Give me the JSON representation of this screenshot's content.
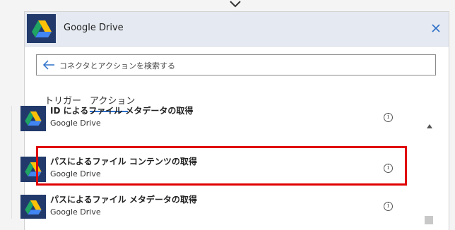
{
  "header": {
    "title": "Google Drive",
    "icon": "google-drive-icon",
    "close_icon": "close-icon"
  },
  "search": {
    "placeholder": "コネクタとアクションを検索する",
    "back_icon": "arrow-left-icon"
  },
  "tabs": [
    {
      "label": "トリガー",
      "selected": false
    },
    {
      "label": "アクション",
      "selected": true
    }
  ],
  "actions": [
    {
      "title": "ID によるファイル メタデータの取得",
      "subtitle": "Google Drive",
      "info": "i"
    },
    {
      "title": "パスによるファイル コンテンツの取得",
      "subtitle": "Google Drive",
      "info": "i",
      "highlighted": true
    },
    {
      "title": "パスによるファイル メタデータの取得",
      "subtitle": "Google Drive",
      "info": "i"
    }
  ],
  "colors": {
    "accent": "#2c6fc9",
    "highlight": "#e00000",
    "icon_bg": "#223a6b"
  }
}
